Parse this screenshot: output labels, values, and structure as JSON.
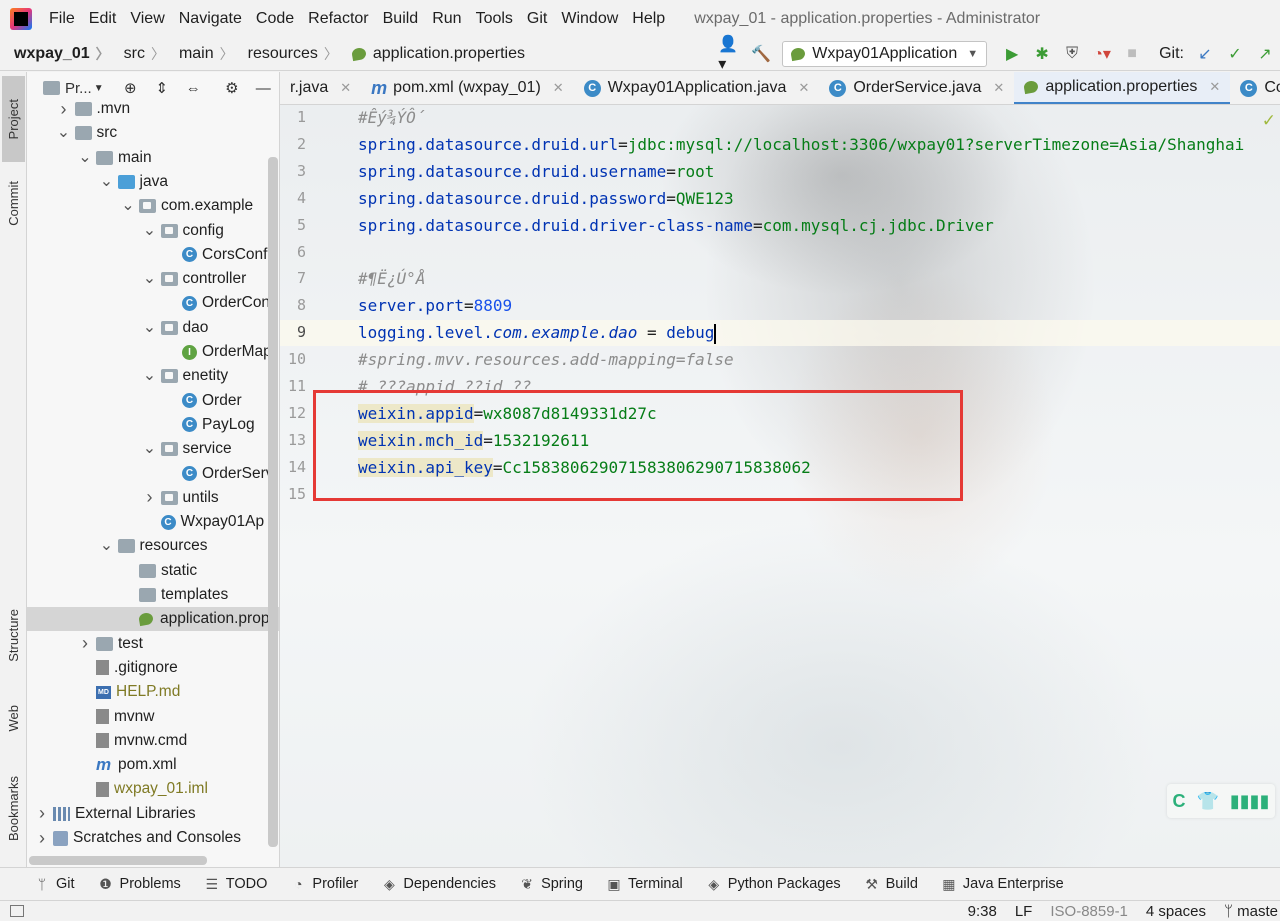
{
  "menubar": {
    "items": [
      "File",
      "Edit",
      "View",
      "Navigate",
      "Code",
      "Refactor",
      "Build",
      "Run",
      "Tools",
      "Git",
      "Window",
      "Help"
    ],
    "window_title": "wxpay_01 - application.properties - Administrator"
  },
  "breadcrumb": {
    "items": [
      "wxpay_01",
      "src",
      "main",
      "resources",
      "application.properties"
    ]
  },
  "toolbar": {
    "run_config": "Wxpay01Application",
    "git_label": "Git:"
  },
  "left_strip": {
    "tabs": [
      "Project",
      "Commit",
      "Structure",
      "Web",
      "Bookmarks"
    ]
  },
  "project_panel": {
    "title": "Pr...",
    "tree": [
      {
        "label": ".mvn",
        "depth": 1,
        "icon": "folder-icon",
        "chevron": "right"
      },
      {
        "label": "src",
        "depth": 1,
        "icon": "folder-icon",
        "chevron": "down"
      },
      {
        "label": "main",
        "depth": 2,
        "icon": "folder-icon",
        "chevron": "down"
      },
      {
        "label": "java",
        "depth": 3,
        "icon": "source-folder-icon",
        "chevron": "down"
      },
      {
        "label": "com.example",
        "depth": 4,
        "icon": "package-icon",
        "chevron": "down"
      },
      {
        "label": "config",
        "depth": 5,
        "icon": "package-icon",
        "chevron": "down"
      },
      {
        "label": "CorsConfi",
        "depth": 6,
        "icon": "class-icon",
        "chevron": ""
      },
      {
        "label": "controller",
        "depth": 5,
        "icon": "package-icon",
        "chevron": "down"
      },
      {
        "label": "OrderCon",
        "depth": 6,
        "icon": "class-icon",
        "chevron": ""
      },
      {
        "label": "dao",
        "depth": 5,
        "icon": "package-icon",
        "chevron": "down"
      },
      {
        "label": "OrderMap",
        "depth": 6,
        "icon": "interface-icon",
        "chevron": ""
      },
      {
        "label": "enetity",
        "depth": 5,
        "icon": "package-icon",
        "chevron": "down"
      },
      {
        "label": "Order",
        "depth": 6,
        "icon": "class-icon",
        "chevron": ""
      },
      {
        "label": "PayLog",
        "depth": 6,
        "icon": "class-icon",
        "chevron": ""
      },
      {
        "label": "service",
        "depth": 5,
        "icon": "package-icon",
        "chevron": "down"
      },
      {
        "label": "OrderServ",
        "depth": 6,
        "icon": "class-icon",
        "chevron": ""
      },
      {
        "label": "untils",
        "depth": 5,
        "icon": "package-icon",
        "chevron": "right"
      },
      {
        "label": "Wxpay01Ap",
        "depth": 5,
        "icon": "spring-class-icon",
        "chevron": ""
      },
      {
        "label": "resources",
        "depth": 3,
        "icon": "resources-folder-icon",
        "chevron": "down"
      },
      {
        "label": "static",
        "depth": 4,
        "icon": "folder-icon",
        "chevron": ""
      },
      {
        "label": "templates",
        "depth": 4,
        "icon": "folder-icon",
        "chevron": ""
      },
      {
        "label": "application.prop",
        "depth": 4,
        "icon": "properties-file-icon",
        "chevron": "",
        "selected": true
      },
      {
        "label": "test",
        "depth": 2,
        "icon": "folder-icon",
        "chevron": "right"
      },
      {
        "label": ".gitignore",
        "depth": 2,
        "icon": "file-icon",
        "chevron": ""
      },
      {
        "label": "HELP.md",
        "depth": 2,
        "icon": "markdown-icon",
        "chevron": "",
        "olive": true
      },
      {
        "label": "mvnw",
        "depth": 2,
        "icon": "terminal-file-icon",
        "chevron": ""
      },
      {
        "label": "mvnw.cmd",
        "depth": 2,
        "icon": "file-icon",
        "chevron": ""
      },
      {
        "label": "pom.xml",
        "depth": 2,
        "icon": "maven-icon",
        "chevron": ""
      },
      {
        "label": "wxpay_01.iml",
        "depth": 2,
        "icon": "iml-file-icon",
        "chevron": "",
        "olive": true
      },
      {
        "label": "External Libraries",
        "depth": 0,
        "icon": "library-icon",
        "chevron": "right"
      },
      {
        "label": "Scratches and Consoles",
        "depth": 0,
        "icon": "scratch-icon",
        "chevron": "right"
      }
    ]
  },
  "editor_tabs": [
    {
      "label": "r.java",
      "icon": "",
      "active": false
    },
    {
      "label": "pom.xml (wxpay_01)",
      "icon": "maven",
      "active": false
    },
    {
      "label": "Wxpay01Application.java",
      "icon": "spring-class",
      "active": false
    },
    {
      "label": "OrderService.java",
      "icon": "class",
      "active": false
    },
    {
      "label": "application.properties",
      "icon": "properties",
      "active": true
    },
    {
      "label": "CorsC",
      "icon": "class",
      "active": false
    }
  ],
  "editor": {
    "line_numbers": [
      "1",
      "2",
      "3",
      "4",
      "5",
      "6",
      "7",
      "8",
      "9",
      "10",
      "11",
      "12",
      "13",
      "14",
      "15"
    ],
    "current_line": "9",
    "lines": {
      "l1": "#Êý¾ÝÔ´",
      "l2_key": "spring.datasource.druid.url",
      "l2_val": "jdbc:mysql://localhost:3306/wxpay01?serverTimezone=Asia/Shanghai",
      "l3_key": "spring.datasource.druid.username",
      "l3_val": "root",
      "l4_key": "spring.datasource.druid.password",
      "l4_val": "QWE123",
      "l5_key": "spring.datasource.druid.driver-class-name",
      "l5_val": "com.mysql.cj.jdbc.Driver",
      "l7": "#¶Ë¿Ú°Å",
      "l8_key": "server.port",
      "l8_val": "8809",
      "l9_key_a": "logging.level.",
      "l9_key_b": "com.example.dao",
      "l9_val": "debug",
      "l10": "#spring.mvv.resources.add-mapping=false",
      "l11": "# ???appid ??id ??",
      "l12_key": "weixin.appid",
      "l12_val": "wx8087d8149331d27c",
      "l13_key": "weixin.mch_id",
      "l13_val": "1532192611",
      "l14_key": "weixin.api_key",
      "l14_val": "Cc158380629071583806290715838062",
      "eq": "=",
      "eq_spaced": " = "
    }
  },
  "bottom_tools": [
    "Git",
    "Problems",
    "TODO",
    "Profiler",
    "Dependencies",
    "Spring",
    "Terminal",
    "Python Packages",
    "Build",
    "Java Enterprise"
  ],
  "statusbar": {
    "position": "9:38",
    "line_sep": "LF",
    "encoding": "ISO-8859-1",
    "indent": "4 spaces",
    "branch": "maste"
  },
  "colors": {
    "accent": "#4083c9",
    "highlight_box": "#e53935",
    "keyword": "#0033b3",
    "value": "#067d17",
    "number": "#1750eb"
  }
}
